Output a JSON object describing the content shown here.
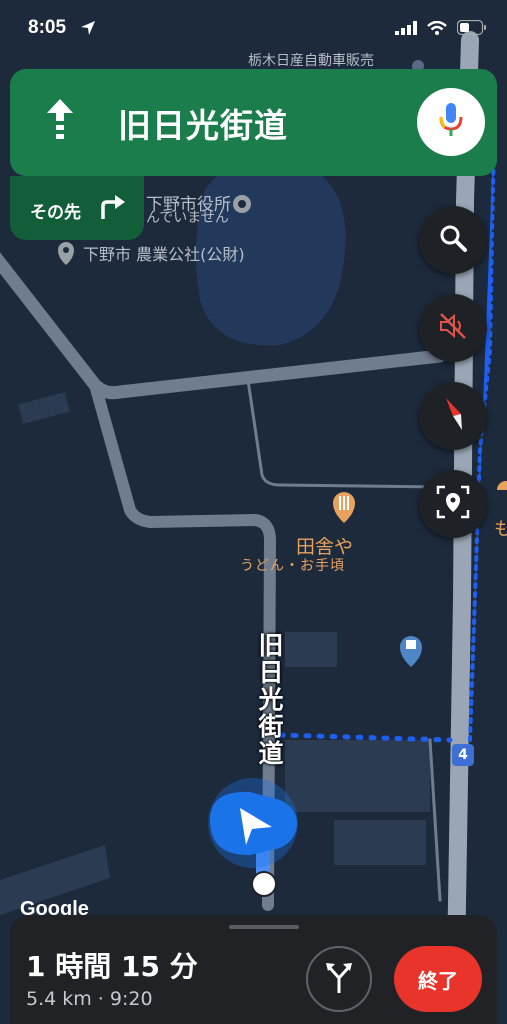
{
  "status_bar": {
    "time": "8:05",
    "icons": [
      "location-arrow-icon",
      "cellular-signal-icon",
      "wifi-icon",
      "battery-icon"
    ]
  },
  "navigation": {
    "direction_icon": "straight-arrow-icon",
    "street": "旧日光街道",
    "then_label": "その先",
    "then_icon": "turn-right-icon",
    "voice_icon": "mic-icon"
  },
  "map_controls": [
    {
      "name": "search",
      "icon": "search-icon"
    },
    {
      "name": "mute",
      "icon": "sound-muted-icon"
    },
    {
      "name": "compass",
      "icon": "compass-icon"
    },
    {
      "name": "recenter",
      "icon": "location-focus-icon"
    }
  ],
  "map": {
    "top_label": "栃木日産自動車販売",
    "city_hall": "下野市役所",
    "city_hall_sub": "んでいません",
    "agri_corp": "下野市 農業公社(公財)",
    "restaurant_name": "田舎や",
    "restaurant_sub": "うどん・お手頃",
    "street_label": "旧日光街道",
    "route_number": "4",
    "side_label": "も",
    "google_logo": "Google",
    "colors": {
      "road": "#7f8c9c",
      "route": "#1e5ef0",
      "water": "#233e62",
      "food_poi": "#e9a15e"
    }
  },
  "bottom_panel": {
    "eta": "1 時間 15 分",
    "distance_time": "5.4 km · 9:20",
    "alt_routes_icon": "alternate-routes-icon",
    "end_label": "終了"
  }
}
